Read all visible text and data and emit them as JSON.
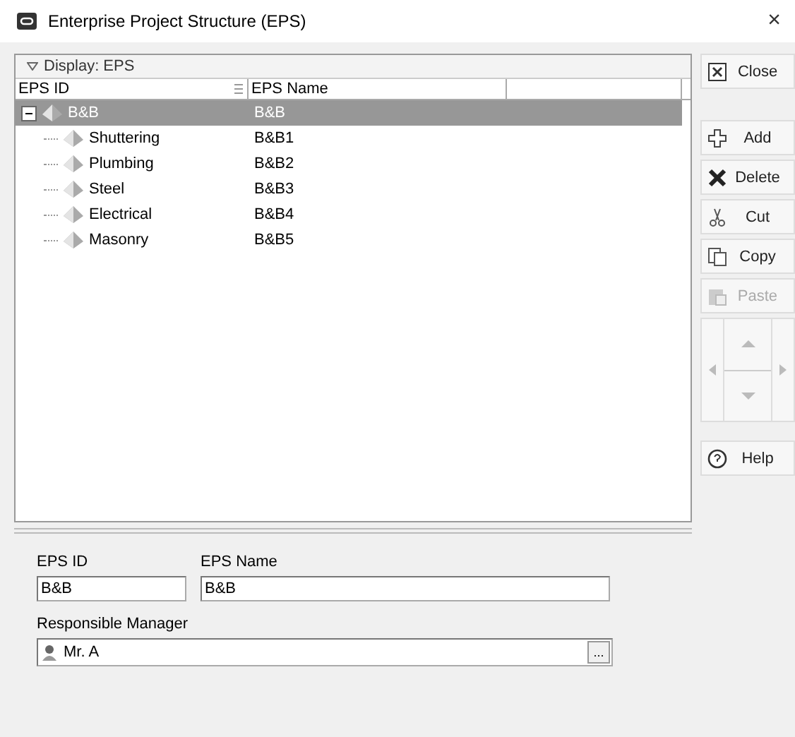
{
  "window": {
    "title": "Enterprise Project Structure (EPS)",
    "close_glyph": "×"
  },
  "display": {
    "label": "Display: EPS",
    "expanded": true
  },
  "table": {
    "columns": [
      "EPS ID",
      "EPS Name"
    ],
    "rows": [
      {
        "id": "B&B",
        "name": "B&B",
        "selected": true,
        "expanded": true,
        "children": [
          {
            "id": "Shuttering",
            "name": "B&B1",
            "selected": false
          },
          {
            "id": "Plumbing",
            "name": "B&B2",
            "selected": false
          },
          {
            "id": "Steel",
            "name": "B&B3",
            "selected": false
          },
          {
            "id": "Electrical",
            "name": "B&B4",
            "selected": false
          },
          {
            "id": "Masonry",
            "name": "B&B5",
            "selected": false
          }
        ]
      }
    ]
  },
  "buttons": [
    {
      "kind": "close",
      "label": "Close",
      "disabled": false
    },
    {
      "kind": "add",
      "label": "Add",
      "disabled": false
    },
    {
      "kind": "delete",
      "label": "Delete",
      "disabled": false
    },
    {
      "kind": "cut",
      "label": "Cut",
      "disabled": false
    },
    {
      "kind": "copy",
      "label": "Copy",
      "disabled": false
    },
    {
      "kind": "paste",
      "label": "Paste",
      "disabled": true
    },
    {
      "kind": "nav"
    },
    {
      "kind": "help",
      "label": "Help",
      "disabled": false
    }
  ],
  "form": {
    "id_label": "EPS ID",
    "id_value": "B&B",
    "name_label": "EPS Name",
    "name_value": "B&B",
    "manager_label": "Responsible Manager",
    "manager_value": "Mr. A",
    "browse_label": "..."
  }
}
